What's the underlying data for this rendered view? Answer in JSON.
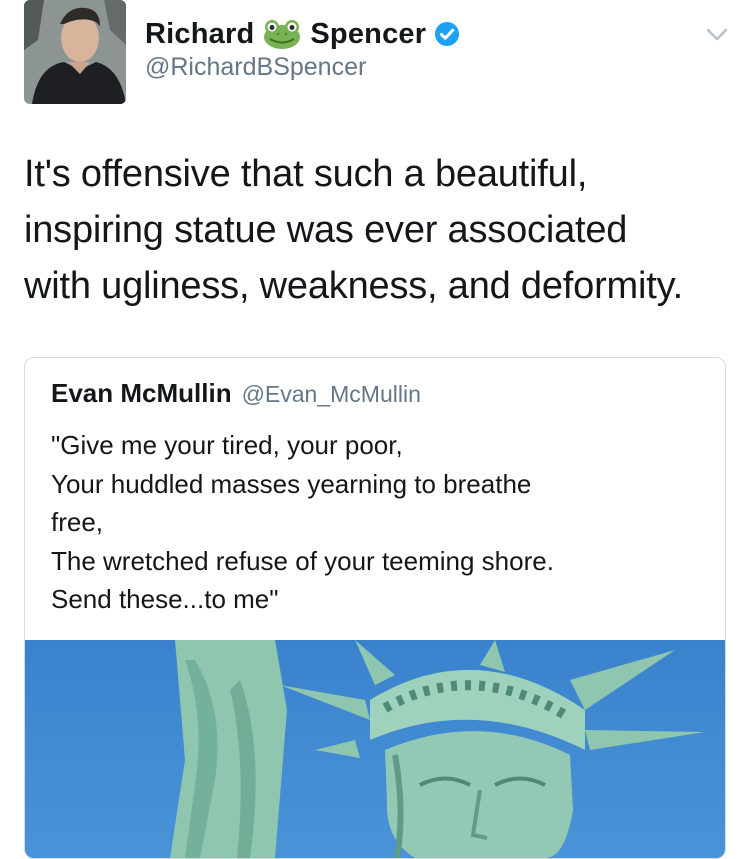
{
  "author": {
    "first_name": "Richard",
    "last_name": "Spencer",
    "emoji_icon": "frog-face-icon",
    "verified_icon": "verified-badge-icon",
    "handle": "@RichardBSpencer"
  },
  "menu_icon": "chevron-down-icon",
  "tweet": {
    "lines": [
      "It's offensive that such a beautiful,",
      "inspiring statue was ever associated",
      "with ugliness, weakness, and deformity."
    ]
  },
  "quoted_tweet": {
    "name": "Evan McMullin",
    "handle": "@Evan_McMullin",
    "lines": [
      "\"Give me your tired, your poor,",
      "Your huddled masses yearning to breathe",
      "free,",
      "The wretched refuse of your teeming shore.",
      "Send these...to me\""
    ],
    "media_icon": "statue-of-liberty-photo"
  },
  "colors": {
    "text": "#14171a",
    "secondary": "#657786",
    "verified": "#1da1f2",
    "sky": "#3e87d0",
    "statue": "#8fc7b1"
  }
}
